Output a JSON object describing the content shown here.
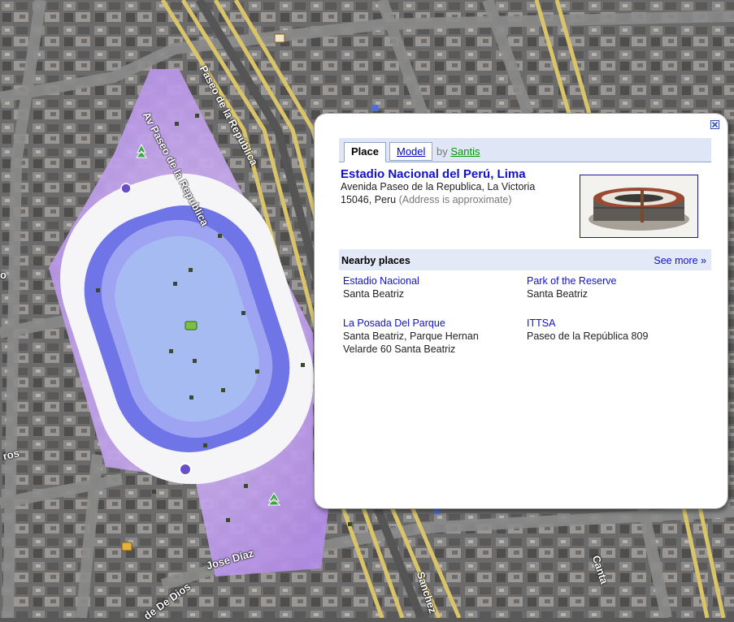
{
  "map": {
    "road_labels": [
      "Av Paseo de la Republica",
      "Paseo de la República",
      "Jose Díaz",
      "ros",
      "de De Dios",
      "Sanchez",
      "Canta",
      "o"
    ]
  },
  "info_window": {
    "close_icon": "close-x-icon",
    "tabs": {
      "place": "Place",
      "model": "Model"
    },
    "by_prefix": "by",
    "author": "Santis",
    "title": "Estadio Nacional del Perú, Lima",
    "address_line1": "Avenida Paseo de la Republica, La Victoria",
    "address_line2": "15046, Peru",
    "address_note": "(Address is approximate)",
    "nearby_title": "Nearby places",
    "see_more": "See more »",
    "nearby": [
      {
        "name": "Estadio Nacional",
        "addr": "Santa Beatriz"
      },
      {
        "name": "Park of the Reserve",
        "addr": "Santa Beatriz"
      },
      {
        "name": "La Posada Del Parque",
        "addr": "Santa Beatriz, Parque Hernan Velarde 60 Santa Beatriz"
      },
      {
        "name": "ITTSA",
        "addr": "Paseo de la República 809"
      }
    ]
  },
  "colors": {
    "link": "#1111cc",
    "author_link": "#009900",
    "tab_bar": "#dfe6f6",
    "stadium_field": "#8a8ff0",
    "stadium_overlay": "#c9a8f0"
  }
}
